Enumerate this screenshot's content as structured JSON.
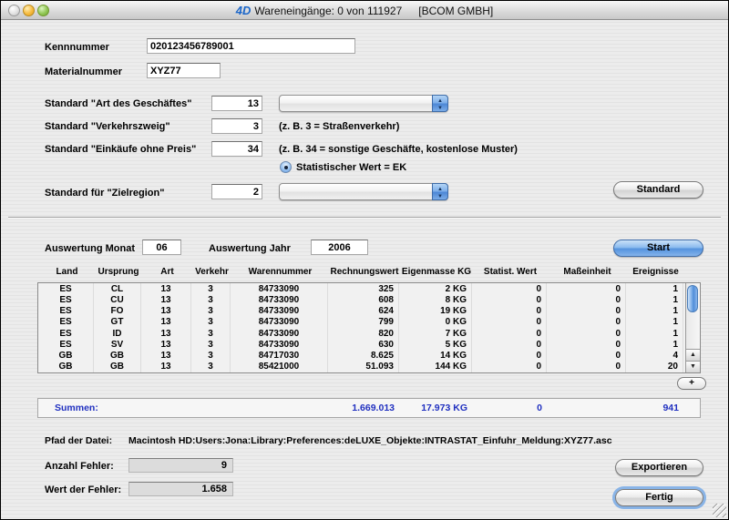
{
  "window": {
    "logo": "4D",
    "title": "Wareneingänge: 0 von 111927",
    "title_suffix": "[BCOM GMBH]"
  },
  "form": {
    "kennnummer": {
      "label": "Kennnummer",
      "value": "020123456789001"
    },
    "materialnummer": {
      "label": "Materialnummer",
      "value": "XYZ77"
    },
    "art_des_geschaeftes": {
      "label": "Standard \"Art des Geschäftes\"",
      "value": "13"
    },
    "verkehrszweig": {
      "label": "Standard \"Verkehrszweig\"",
      "value": "3",
      "hint": "(z. B. 3 = Straßenverkehr)"
    },
    "einkaeufe_ohne_preis": {
      "label": "Standard \"Einkäufe ohne Preis\"",
      "value": "34",
      "hint": "(z. B. 34 = sonstige Geschäfte, kostenlose Muster)"
    },
    "statistischer_wert_radio": {
      "label": "Statistischer Wert = EK",
      "checked": true
    },
    "zielregion": {
      "label": "Standard für \"Zielregion\"",
      "value": "2"
    },
    "standard_button": "Standard"
  },
  "auswertung": {
    "monat_label": "Auswertung Monat",
    "monat_value": "06",
    "jahr_label": "Auswertung Jahr",
    "jahr_value": "2006",
    "start_button": "Start"
  },
  "table": {
    "columns": [
      "Land",
      "Ursprung",
      "Art",
      "Verkehr",
      "Warennummer",
      "Rechnungswert",
      "Eigenmasse KG",
      "Statist. Wert",
      "Maßeinheit",
      "Ereignisse"
    ],
    "rows": [
      [
        "ES",
        "CL",
        "13",
        "3",
        "84733090",
        "325",
        "2 KG",
        "0",
        "0",
        "1"
      ],
      [
        "ES",
        "CU",
        "13",
        "3",
        "84733090",
        "608",
        "8 KG",
        "0",
        "0",
        "1"
      ],
      [
        "ES",
        "FO",
        "13",
        "3",
        "84733090",
        "624",
        "19 KG",
        "0",
        "0",
        "1"
      ],
      [
        "ES",
        "GT",
        "13",
        "3",
        "84733090",
        "799",
        "0 KG",
        "0",
        "0",
        "1"
      ],
      [
        "ES",
        "ID",
        "13",
        "3",
        "84733090",
        "820",
        "7 KG",
        "0",
        "0",
        "1"
      ],
      [
        "ES",
        "SV",
        "13",
        "3",
        "84733090",
        "630",
        "5 KG",
        "0",
        "0",
        "1"
      ],
      [
        "GB",
        "GB",
        "13",
        "3",
        "84717030",
        "8.625",
        "14 KG",
        "0",
        "0",
        "4"
      ],
      [
        "GB",
        "GB",
        "13",
        "3",
        "85421000",
        "51.093",
        "144 KG",
        "0",
        "0",
        "20"
      ]
    ],
    "add_button": "+",
    "summen": {
      "label": "Summen:",
      "rechnungswert": "1.669.013",
      "eigenmasse": "17.973 KG",
      "statist_wert": "0",
      "ereignisse": "941"
    }
  },
  "footer": {
    "pfad_label": "Pfad der Datei:",
    "pfad_value": "Macintosh HD:Users:Jona:Library:Preferences:deLUXE_Objekte:INTRASTAT_Einfuhr_Meldung:XYZ77.asc",
    "anzahl_fehler_label": "Anzahl Fehler:",
    "anzahl_fehler_value": "9",
    "wert_fehler_label": "Wert der Fehler:",
    "wert_fehler_value": "1.658",
    "exportieren_button": "Exportieren",
    "fertig_button": "Fertig"
  },
  "colors": {
    "start_button_blue": "#5593de",
    "summen_text_blue": "#2030c0",
    "logo_blue": "#1b66c9",
    "scroll_thumb_blue": "#4f8cd8"
  }
}
